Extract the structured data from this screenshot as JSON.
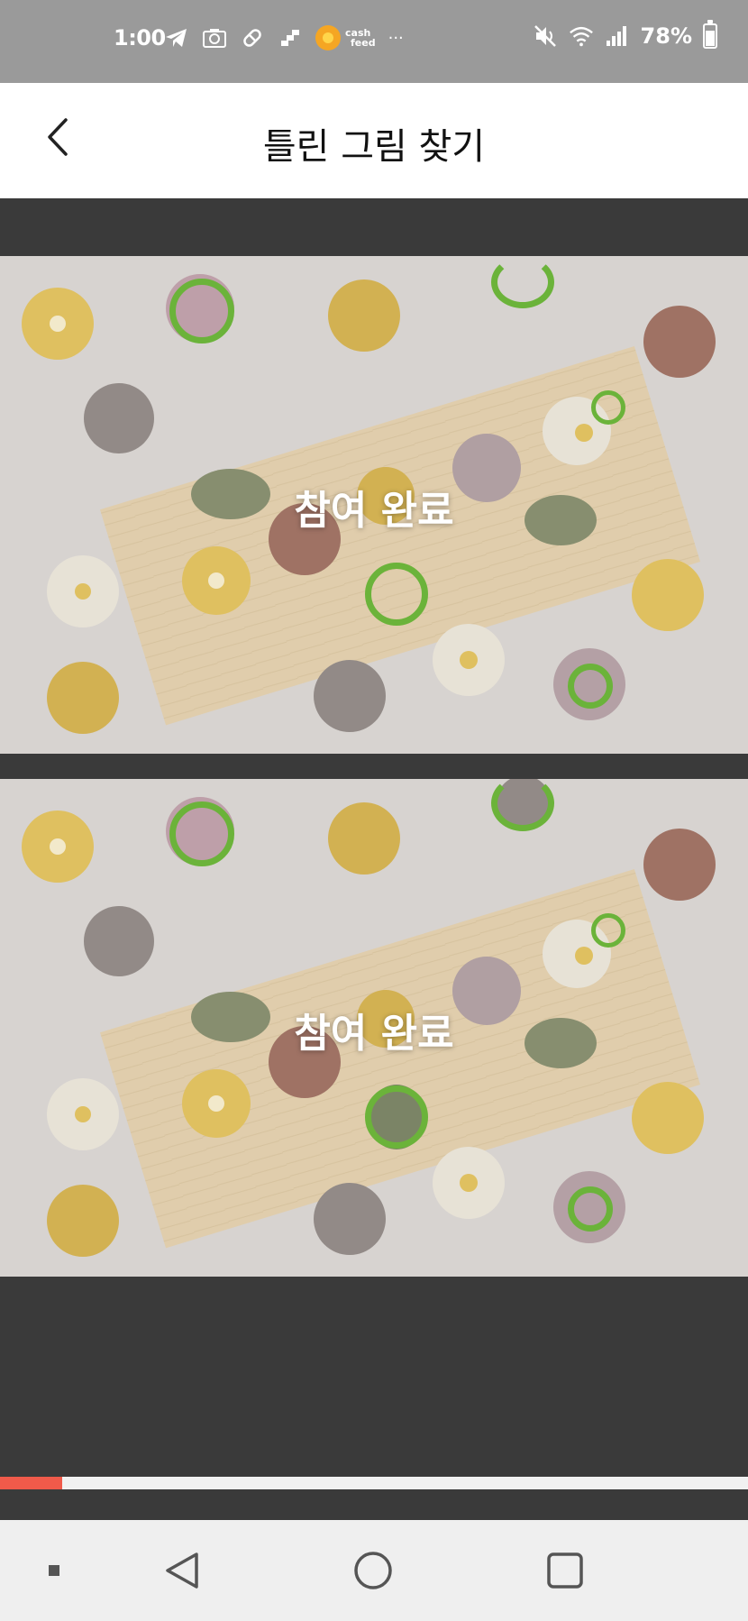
{
  "status_bar": {
    "time": "1:00",
    "cashfeed_line1": "cash",
    "cashfeed_line2": "feed",
    "more": "···",
    "battery": "78%",
    "battery_level": 0.78
  },
  "header": {
    "title": "틀린 그림 찾기"
  },
  "puzzle": {
    "completed_label": "참여 완료",
    "top_image_name": "original-picture",
    "bottom_image_name": "modified-picture",
    "marker_color": "#6bb33a"
  },
  "progress": {
    "fraction": 0.083,
    "color": "#f05a4a"
  },
  "colors": {
    "status_bar_bg": "#9a9a9a",
    "header_bg": "#ffffff",
    "game_bg": "#3a3a3a",
    "nav_bar_bg": "#efefef"
  },
  "icons": {
    "back": "chevron-left-icon",
    "nav_recent": "square-icon",
    "nav_home": "circle-icon",
    "nav_back": "triangle-left-icon"
  }
}
